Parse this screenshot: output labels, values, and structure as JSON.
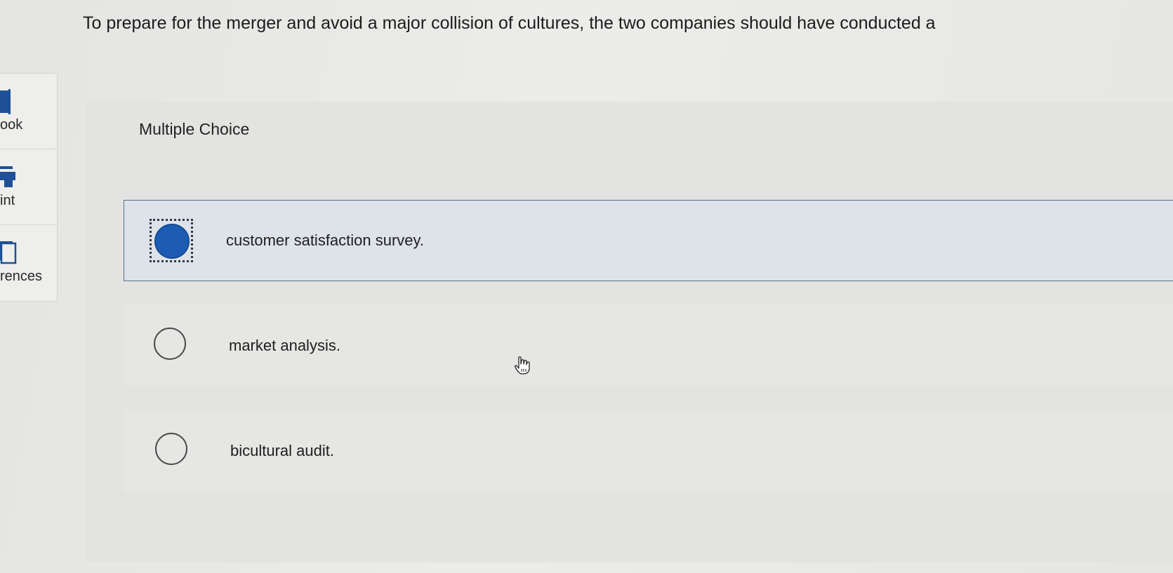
{
  "question": {
    "prompt": "To prepare for the merger and avoid a major collision of cultures, the two companies should have conducted a"
  },
  "sidebar": {
    "items": [
      {
        "label": "ook",
        "icon": "book-icon"
      },
      {
        "label": "int",
        "icon": "print-icon"
      },
      {
        "label": "rences",
        "icon": "references-icon"
      }
    ]
  },
  "multiple_choice": {
    "header": "Multiple Choice",
    "options": [
      {
        "label": "customer satisfaction survey.",
        "selected": true
      },
      {
        "label": "market analysis.",
        "selected": false
      },
      {
        "label": "bicultural audit.",
        "selected": false
      }
    ]
  },
  "colors": {
    "selected_radio": "#1d5cb4",
    "selected_border": "#5b7088",
    "selected_background": "#dde3e8"
  }
}
